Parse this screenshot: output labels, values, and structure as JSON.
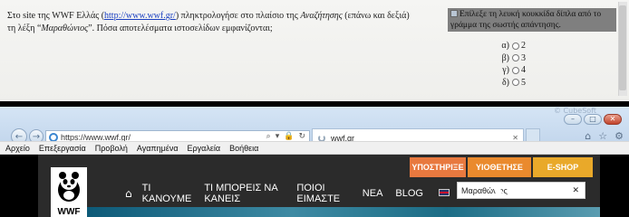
{
  "quiz": {
    "question_line1_pre": "Στο site της WWF Ελλάς (",
    "question_link": "http://www.wwf.gr/",
    "question_line1_post": ") πληκτρολογήσε στο πλαίσιο της ",
    "question_search_word": "Αναζήτησης",
    "question_line1_end": " (επάνω και δεξιά)",
    "question_line2_pre": "τη λέξη “",
    "question_term": "Μαραθώνιος",
    "question_line2_post": "”. Πόσα αποτελέσματα ιστοσελίδων εμφανίζονται;",
    "instruction": "Επίλεξε τη λευκή κουκκίδα δίπλα από το γράμμα της σωστής απάντησης.",
    "options": [
      {
        "letter": "α)",
        "value": "2"
      },
      {
        "letter": "β)",
        "value": "3"
      },
      {
        "letter": "γ)",
        "value": "4"
      },
      {
        "letter": "δ)",
        "value": "5"
      }
    ]
  },
  "browser": {
    "brand": "© CubeSoft",
    "address_url": "https://www.wwf.gr/",
    "tab_title": "wwf.gr",
    "menu": [
      "Αρχείο",
      "Επεξεργασία",
      "Προβολή",
      "Αγαπημένα",
      "Εργαλεία",
      "Βοήθεια"
    ]
  },
  "site": {
    "logo_text": "WWF",
    "cta_buttons": [
      {
        "label": "ΥΠΟΣΤΗΡΙΞΕ",
        "color": "#e8793f"
      },
      {
        "label": "ΥΙΟΘΕΤΗΣΕ",
        "color": "#ea8a2d"
      },
      {
        "label": "E-SHOP",
        "color": "#e9a92a"
      }
    ],
    "nav": [
      "ΤΙ ΚΑΝΟΥΜΕ",
      "ΤΙ ΜΠΟΡΕΙΣ ΝΑ ΚΑΝΕΙΣ",
      "ΠΟΙΟΙ ΕΙΜΑΣΤΕ",
      "ΝΕΑ",
      "BLOG"
    ],
    "search_value": "Μαραθώνιος"
  },
  "colors": {
    "site_background": "#2b2b2b",
    "link": "#1a3fc0"
  }
}
